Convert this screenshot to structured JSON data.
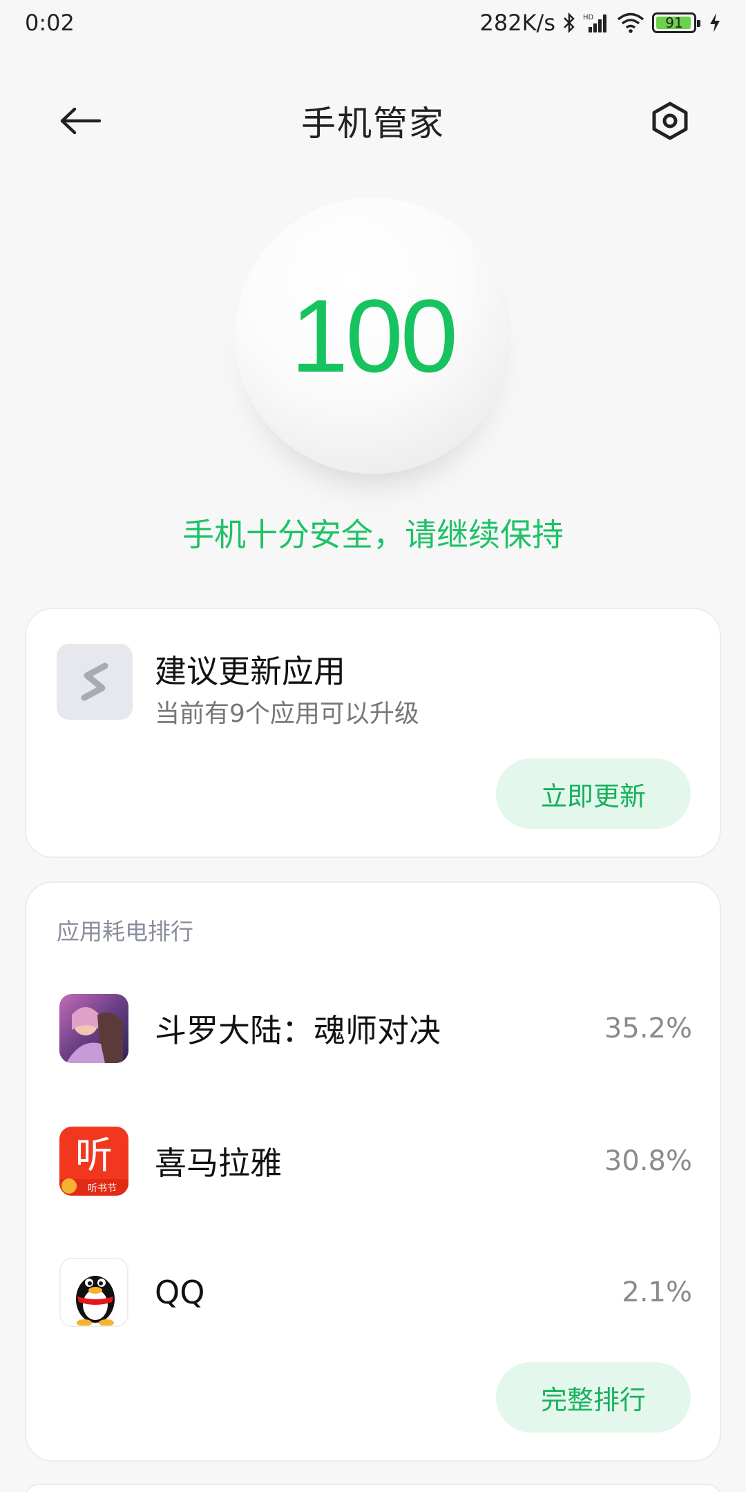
{
  "status_bar": {
    "time": "0:02",
    "network_speed": "282K/s",
    "battery": "91",
    "battery_level": 0.91,
    "icons": [
      "bluetooth-icon",
      "hd-signal-icon",
      "wifi-icon",
      "battery-icon",
      "charging-icon"
    ]
  },
  "header": {
    "title": "手机管家",
    "back_icon": "arrow-left-icon",
    "settings_icon": "hexagon-settings-icon"
  },
  "score": {
    "value": "100",
    "message": "手机十分安全，请继续保持",
    "color": "#17c35f"
  },
  "update_card": {
    "title": "建议更新应用",
    "subtitle": "当前有9个应用可以升级",
    "button": "立即更新",
    "icon": "app-store-icon"
  },
  "rank_card": {
    "heading": "应用耗电排行",
    "items": [
      {
        "name": "斗罗大陆：魂师对决",
        "percent": "35.2%",
        "icon": "douluo-app-icon"
      },
      {
        "name": "喜马拉雅",
        "percent": "30.8%",
        "icon": "ximalaya-app-icon",
        "badge_text": "听",
        "banner_text": "听书节"
      },
      {
        "name": "QQ",
        "percent": "2.1%",
        "icon": "qq-app-icon"
      }
    ],
    "button": "完整排行"
  },
  "colors": {
    "accent": "#17b15b",
    "accent_bg": "#e3f7ec",
    "background": "#f7f7f7"
  }
}
